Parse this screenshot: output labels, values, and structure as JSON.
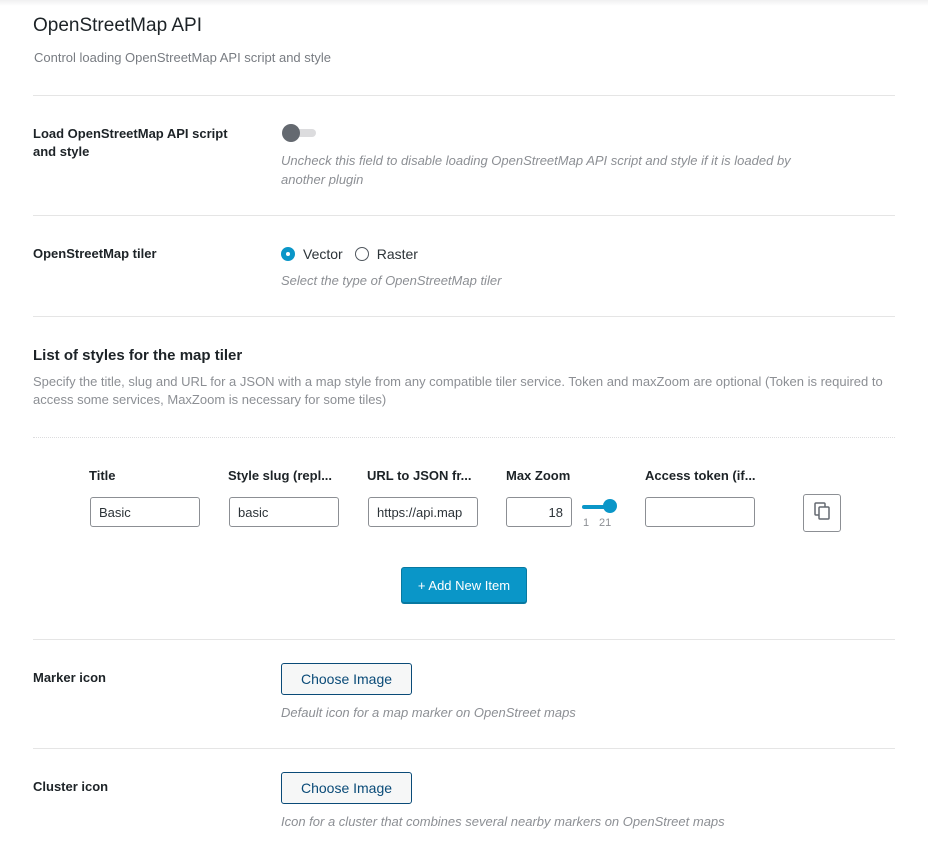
{
  "header": {
    "title": "OpenStreetMap API",
    "description": "Control loading OpenStreetMap API script and style"
  },
  "load_api": {
    "label": "Load OpenStreetMap API script and style",
    "enabled": false,
    "help": "Uncheck this field to disable loading OpenStreetMap API script and style if it is loaded by another plugin"
  },
  "tiler": {
    "label": "OpenStreetMap tiler",
    "options": [
      {
        "label": "Vector",
        "selected": true
      },
      {
        "label": "Raster",
        "selected": false
      }
    ],
    "help": "Select the type of OpenStreetMap tiler"
  },
  "styles_list": {
    "title": "List of styles for the map tiler",
    "description": "Specify the title, slug and URL for a JSON with a map style from any compatible tiler service. Token and maxZoom are optional (Token is required to access some services, MaxZoom is necessary for some tiles)",
    "columns": [
      "Title",
      "Style slug (repl...",
      "URL to JSON fr...",
      "Max Zoom",
      "Access token (if..."
    ],
    "rows": [
      {
        "title": "Basic",
        "slug": "basic",
        "url": "https://api.map",
        "max_zoom": "18",
        "zoom_min": "1",
        "zoom_max": "21",
        "access_token": ""
      }
    ],
    "copy_icon": "copy-icon",
    "add_label": "+ Add New Item"
  },
  "marker_icon": {
    "label": "Marker icon",
    "button": "Choose Image",
    "help": "Default icon for a map marker on OpenStreet maps"
  },
  "cluster_icon": {
    "label": "Cluster icon",
    "button": "Choose Image",
    "help": "Icon for a cluster that combines several nearby markers on OpenStreet maps"
  },
  "colors": {
    "accent": "#0a96c8",
    "toggle_off": "#646970",
    "help_text": "#8c8f94"
  }
}
